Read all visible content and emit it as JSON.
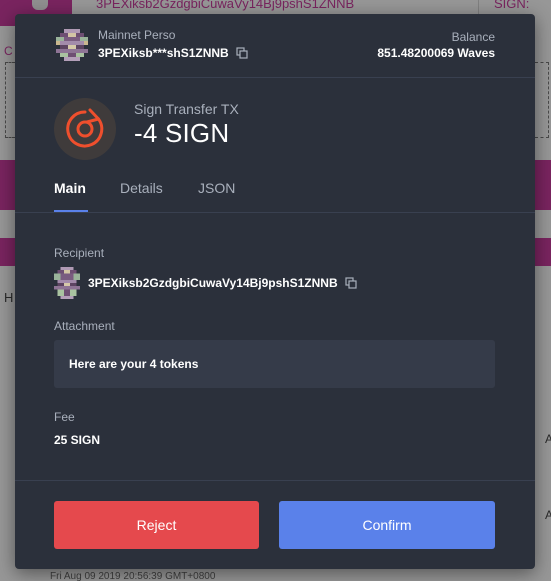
{
  "background": {
    "top_address": "3PEXiksb2GzdgbiCuwaVy14Bj9pshS1ZNNB",
    "top_sign_label": "SIGN:",
    "side_label": "C",
    "h_letter": "H",
    "right_letter_1": "A",
    "right_letter_2": "A",
    "date_text": "Fri Aug 09 2019 20:56:39 GMT+0800"
  },
  "account": {
    "name": "Mainnet Perso",
    "address_short": "3PEXiksb***shS1ZNNB",
    "balance_label": "Balance",
    "balance_value": "851.48200069 Waves"
  },
  "transaction": {
    "title": "Sign Transfer TX",
    "amount": "-4 SIGN",
    "icon": "transfer-out-icon"
  },
  "tabs": [
    {
      "label": "Main",
      "active": true
    },
    {
      "label": "Details",
      "active": false
    },
    {
      "label": "JSON",
      "active": false
    }
  ],
  "fields": {
    "recipient_label": "Recipient",
    "recipient_address": "3PEXiksb2GzdgbiCuwaVy14Bj9pshS1ZNNB",
    "attachment_label": "Attachment",
    "attachment_value": "Here are your 4 tokens",
    "fee_label": "Fee",
    "fee_value": "25 SIGN"
  },
  "buttons": {
    "reject_label": "Reject",
    "confirm_label": "Confirm"
  },
  "colors": {
    "modal_bg": "#2b303b",
    "accent_blue": "#5a81ea",
    "reject_red": "#e5494d",
    "background_magenta": "#c33b99",
    "transfer_icon_orange": "#ef4f2d"
  }
}
